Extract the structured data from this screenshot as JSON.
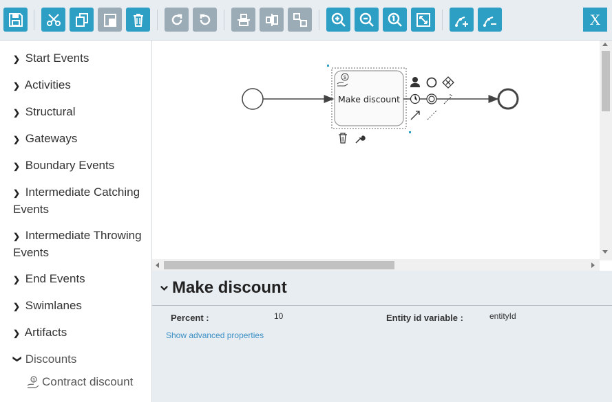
{
  "toolbar": {
    "close_label": "X",
    "buttons": [
      {
        "name": "save",
        "icon": "save-icon",
        "group": 1
      },
      {
        "name": "cut",
        "icon": "scissors-icon",
        "group": 2
      },
      {
        "name": "copy",
        "icon": "copy-icon",
        "group": 2
      },
      {
        "name": "paste",
        "icon": "paste-icon",
        "group": 2
      },
      {
        "name": "delete",
        "icon": "trash-icon",
        "group": 2
      },
      {
        "name": "redo",
        "icon": "redo-icon",
        "group": 3
      },
      {
        "name": "undo",
        "icon": "undo-icon",
        "group": 3
      },
      {
        "name": "align-horizontal",
        "icon": "align-horizontal-icon",
        "group": 4
      },
      {
        "name": "align-vertical",
        "icon": "align-vertical-icon",
        "group": 4
      },
      {
        "name": "same-size",
        "icon": "same-size-icon",
        "group": 4
      },
      {
        "name": "zoom-in",
        "icon": "zoom-in-icon",
        "group": 5
      },
      {
        "name": "zoom-out",
        "icon": "zoom-out-icon",
        "group": 5
      },
      {
        "name": "zoom-actual",
        "icon": "zoom-actual-icon",
        "group": 5
      },
      {
        "name": "zoom-fit",
        "icon": "zoom-fit-icon",
        "group": 5
      },
      {
        "name": "add-bendpoint",
        "icon": "add-bendpoint-icon",
        "group": 6
      },
      {
        "name": "remove-bendpoint",
        "icon": "remove-bendpoint-icon",
        "group": 6
      }
    ],
    "colors": {
      "active": "#2d9ec4",
      "disabled": "#9cacb7",
      "background": "#e8edf2"
    }
  },
  "sidebar": {
    "categories": [
      {
        "label": "Start Events",
        "expanded": false
      },
      {
        "label": "Activities",
        "expanded": false
      },
      {
        "label": "Structural",
        "expanded": false
      },
      {
        "label": "Gateways",
        "expanded": false
      },
      {
        "label": "Boundary Events",
        "expanded": false
      },
      {
        "label": "Intermediate Catching Events",
        "expanded": false
      },
      {
        "label": "Intermediate Throwing Events",
        "expanded": false
      },
      {
        "label": "End Events",
        "expanded": false
      },
      {
        "label": "Swimlanes",
        "expanded": false
      },
      {
        "label": "Artifacts",
        "expanded": false
      },
      {
        "label": "Discounts",
        "expanded": true
      }
    ],
    "sub_items": [
      {
        "label": "Contract discount",
        "icon": "discount-icon"
      }
    ]
  },
  "canvas": {
    "task": {
      "label": "Make discount",
      "icon": "discount-icon",
      "selected": true
    },
    "start_event": "start-event",
    "end_event": "end-event",
    "context_pad_icons": [
      "user-task-icon",
      "intermediate-event-icon",
      "gateway-icon",
      "timer-event-icon",
      "end-event-icon",
      "sequence-flow-icon",
      "connector-icon",
      "association-icon",
      "trash-icon",
      "wrench-icon"
    ]
  },
  "properties": {
    "title": "Make discount",
    "fields": [
      {
        "label": "Percent :",
        "value": "10"
      },
      {
        "label": "Entity id variable :",
        "value": "entityId"
      }
    ],
    "advanced_link": "Show advanced properties"
  }
}
